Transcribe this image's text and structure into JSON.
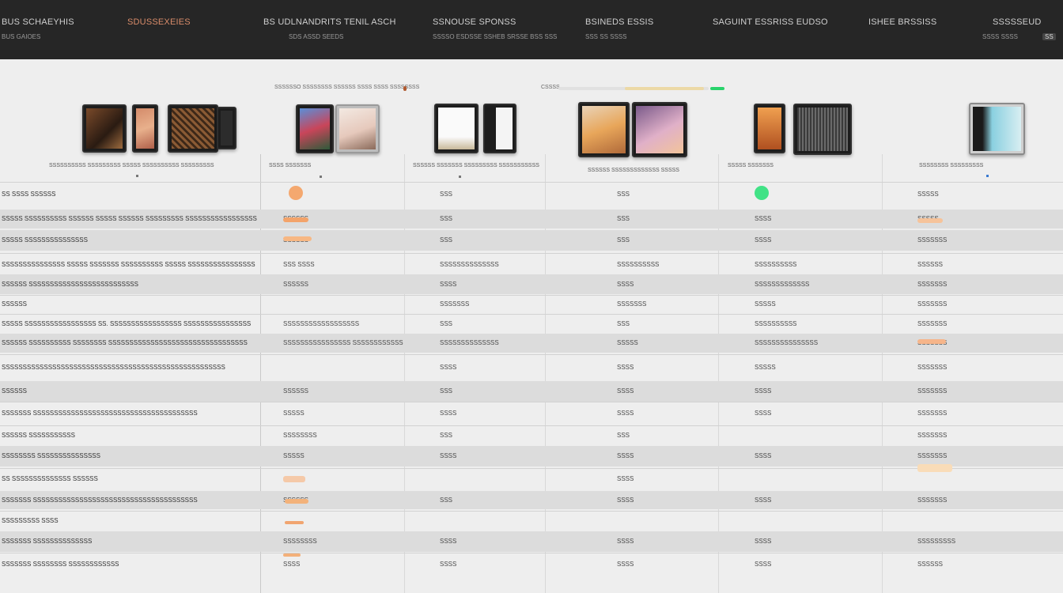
{
  "nav": {
    "items": [
      {
        "label": "BUS SCHAEYHIS",
        "sub": "BUS GAIOES"
      },
      {
        "label": "SDUSSEXEIES",
        "sub": ""
      },
      {
        "label": "BS UDLNANDRITS TENIL ASCH",
        "sub": "SDS ASSD SEEDS"
      },
      {
        "label": "SSNOUSE SPONSS",
        "sub": "SSSSO ESDSSE SSHEB SRSSE BSS SSS"
      },
      {
        "label": "BSINEDS ESSIS",
        "sub": "SSS SS SSSS"
      },
      {
        "label": "SAGUINT ESSRISS EUDSO",
        "sub": ""
      },
      {
        "label": "ISHEE BRSSISS",
        "sub": ""
      },
      {
        "label": "SSSSSEUD",
        "sub": "SSSS SSSS"
      }
    ],
    "badge": "SS"
  },
  "header": {
    "note_left": "SSSSSSO SSSSSSSS SSSSSS SSSS SSSS SSSSSSSS",
    "note_right": "CSSSS",
    "colors": {
      "bar": "#e3e3e3",
      "accent_orange": "#f28a3a",
      "accent_green": "#28d36b"
    }
  },
  "products": [
    {
      "name": "SSSSSSSSSS SSSSSSSSS SSSSS SSSSSSSSSS SSSSSSSSS"
    },
    {
      "name": "SSSS SSSSSSS"
    },
    {
      "name": "SSSSSS SSSSSSS SSSSSSSSS SSSSSSSSSSS"
    },
    {
      "name": "SSSSSS SSSSSSSSSSSSS SSSSS"
    },
    {
      "name": "SSSSS SSSSSSS"
    },
    {
      "name": "SSSSSSSS SSSSSSSSS"
    }
  ],
  "rows": [
    {
      "label": "SS SSSS SSSSSS",
      "c1": "",
      "c2": "SSS",
      "c3": "SSS",
      "c4": "",
      "c5": "SSSSS"
    },
    {
      "label": "SSSSS SSSSSSSSSS SSSSSS SSSSS SSSSSS SSSSSSSSS SSSSSSSSSSSSSSSSS",
      "c1": "SSSSSS",
      "c2": "SSS",
      "c3": "SSS",
      "c4": "SSSS",
      "c5": "SSSSS"
    },
    {
      "label": "SSSSS SSSSSSSSSSSSSSS",
      "c1": "SSSSSS",
      "c2": "SSS",
      "c3": "SSS",
      "c4": "SSSS",
      "c5": "SSSSSSS"
    },
    {
      "label": "SSSSSSSSSSSSSSS SSSSS SSSSSSS SSSSSSSSSS SSSSS SSSSSSSSSSSSSSSS",
      "c1": "SSS SSSS",
      "c2": "SSSSSSSSSSSSSS",
      "c3": "SSSSSSSSSS",
      "c4": "SSSSSSSSSS",
      "c5": "SSSSSS"
    },
    {
      "label": "SSSSSS SSSSSSSSSSSSSSSSSSSSSSSSSS",
      "c1": "SSSSSS",
      "c2": "SSSS",
      "c3": "SSSS",
      "c4": "SSSSSSSSSSSSS",
      "c5": "SSSSSSS"
    },
    {
      "label": "SSSSSS",
      "c1": "",
      "c2": "SSSSSSS",
      "c3": "SSSSSSS",
      "c4": "SSSSS",
      "c5": "SSSSSSS"
    },
    {
      "label": "SSSSS SSSSSSSSSSSSSSSSS SS. SSSSSSSSSSSSSSSSS SSSSSSSSSSSSSSSS",
      "c1": "SSSSSSSSSSSSSSSSSS",
      "c2": "SSS",
      "c3": "SSS",
      "c4": "SSSSSSSSSS",
      "c5": "SSSSSSS"
    },
    {
      "label": "SSSSSS SSSSSSSSSS SSSSSSSS SSSSSSSSSSSSSSSSSSSSSSSSSSSSSSSSS",
      "c1": "SSSSSSSSSSSSSSSS SSSSSSSSSSSS",
      "c2": "SSSSSSSSSSSSSS",
      "c3": "SSSSS",
      "c4": "SSSSSSSSSSSSSSS",
      "c5": "SSSSSSS"
    },
    {
      "label": "SSSSSSSSSSSSSSSSSSSSSSSSSSSSSSSSSSSSSSSSSSSSSSSSSSSSS",
      "c1": "",
      "c2": "SSSS",
      "c3": "SSSS",
      "c4": "SSSSS",
      "c5": "SSSSSSS"
    },
    {
      "label": "SSSSSS",
      "c1": "SSSSSS",
      "c2": "SSS",
      "c3": "SSSS",
      "c4": "SSSS",
      "c5": "SSSSSSS"
    },
    {
      "label": "SSSSSSS SSSSSSSSSSSSSSSSSSSSSSSSSSSSSSSSSSSSSSS",
      "c1": "SSSSS",
      "c2": "SSSS",
      "c3": "SSSS",
      "c4": "SSSS",
      "c5": "SSSSSSS"
    },
    {
      "label": "SSSSSS   SSSSSSSSSSS",
      "c1": "SSSSSSSS",
      "c2": "SSS",
      "c3": "SSS",
      "c4": "",
      "c5": "SSSSSSS"
    },
    {
      "label": "SSSSSSSS SSSSSSSSSSSSSSS",
      "c1": "SSSSS",
      "c2": "SSSS",
      "c3": "SSSS",
      "c4": "SSSS",
      "c5": "SSSSSSS"
    },
    {
      "label": "SS   SSSSSSSSSSSSSS SSSSSS",
      "c1": "",
      "c2": "",
      "c3": "SSSS",
      "c4": "",
      "c5": ""
    },
    {
      "label": "SSSSSSS SSSSSSSSSSSSSSSSSSSSSSSSSSSSSSSSSSSSSSS",
      "c1": "SSSSSS",
      "c2": "SSS",
      "c3": "SSSS",
      "c4": "SSSS",
      "c5": "SSSSSSS"
    },
    {
      "label": "SSSSSSSSS   SSSS",
      "c1": "",
      "c2": "",
      "c3": "",
      "c4": "",
      "c5": ""
    },
    {
      "label": "SSSSSSS SSSSSSSSSSSSSS",
      "c1": "SSSSSSSS",
      "c2": "SSSS",
      "c3": "SSSS",
      "c4": "SSSS",
      "c5": "SSSSSSSSS"
    },
    {
      "label": "SSSSSSS SSSSSSSS SSSSSSSSSSSS",
      "c1": "SSSS",
      "c2": "SSSS",
      "c3": "SSSS",
      "c4": "SSSS",
      "c5": "SSSSSS"
    }
  ]
}
